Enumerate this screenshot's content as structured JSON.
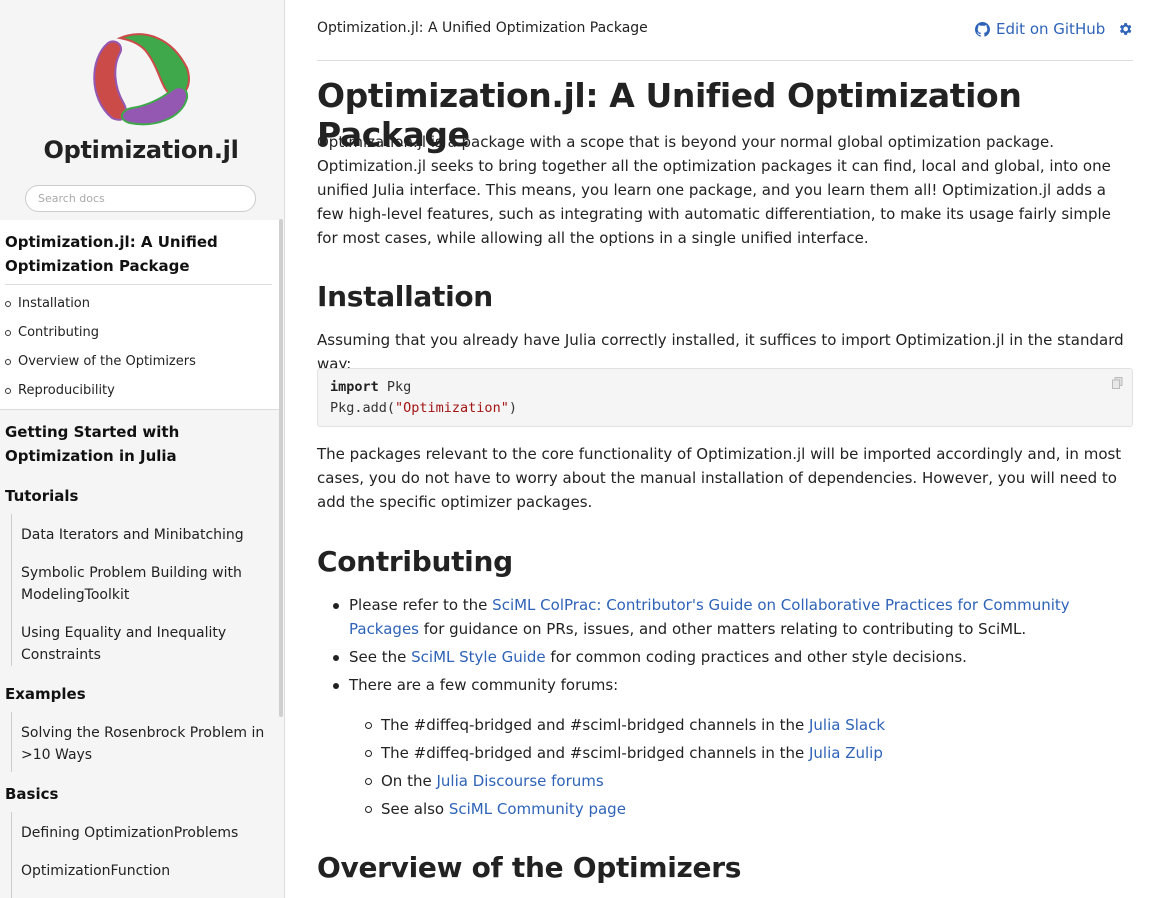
{
  "sidebar": {
    "site_name": "Optimization.jl",
    "search_placeholder": "Search docs",
    "current_page": "Optimization.jl: A Unified Optimization Package",
    "toc": [
      "Installation",
      "Contributing",
      "Overview of the Optimizers",
      "Reproducibility"
    ],
    "sections": [
      {
        "heading": "Getting Started with Optimization in Julia"
      },
      {
        "heading": "Tutorials",
        "items": [
          "Data Iterators and Minibatching",
          "Symbolic Problem Building with ModelingToolkit",
          "Using Equality and Inequality Constraints"
        ]
      },
      {
        "heading": "Examples",
        "items": [
          "Solving the Rosenbrock Problem in >10 Ways"
        ]
      },
      {
        "heading": "Basics",
        "items": [
          "Defining OptimizationProblems",
          "OptimizationFunction"
        ]
      }
    ]
  },
  "topbar": {
    "title": "Optimization.jl: A Unified Optimization Package",
    "edit_label": "Edit on GitHub"
  },
  "content": {
    "h1": "Optimization.jl: A Unified Optimization Package",
    "intro": "Optimization.jl is a package with a scope that is beyond your normal global optimization package. Optimization.jl seeks to bring together all the optimization packages it can find, local and global, into one unified Julia interface. This means, you learn one package, and you learn them all! Optimization.jl adds a few high-level features, such as integrating with automatic differentiation, to make its usage fairly simple for most cases, while allowing all the options in a single unified interface.",
    "installation": {
      "heading": "Installation",
      "text": "Assuming that you already have Julia correctly installed, it suffices to import Optimization.jl in the standard way:",
      "code_kw": "import",
      "code_line1_rest": " Pkg",
      "code_line2_pre": "Pkg.add(",
      "code_line2_str": "\"Optimization\"",
      "code_line2_post": ")",
      "after": "The packages relevant to the core functionality of Optimization.jl will be imported accordingly and, in most cases, you do not have to worry about the manual installation of dependencies. However, you will need to add the specific optimizer packages."
    },
    "contributing": {
      "heading": "Contributing",
      "b1_pre": "Please refer to the ",
      "b1_link": "SciML ColPrac: Contributor's Guide on Collaborative Practices for Community Packages",
      "b1_post": " for guidance on PRs, issues, and other matters relating to contributing to SciML.",
      "b2_pre": "See the ",
      "b2_link": "SciML Style Guide",
      "b2_post": " for common coding practices and other style decisions.",
      "b3": "There are a few community forums:",
      "sub1_pre": "The #diffeq-bridged and #sciml-bridged channels in the ",
      "sub1_link": "Julia Slack",
      "sub2_pre": "The #diffeq-bridged and #sciml-bridged channels in the ",
      "sub2_link": "Julia Zulip",
      "sub3_pre": "On the ",
      "sub3_link": "Julia Discourse forums",
      "sub4_pre": "See also ",
      "sub4_link": "SciML Community page"
    },
    "overview_heading": "Overview of the Optimizers"
  },
  "colors": {
    "link": "#2e63b8",
    "logo_green": "#3ea84a",
    "logo_red": "#cb4b49",
    "logo_purple": "#9558b2"
  }
}
